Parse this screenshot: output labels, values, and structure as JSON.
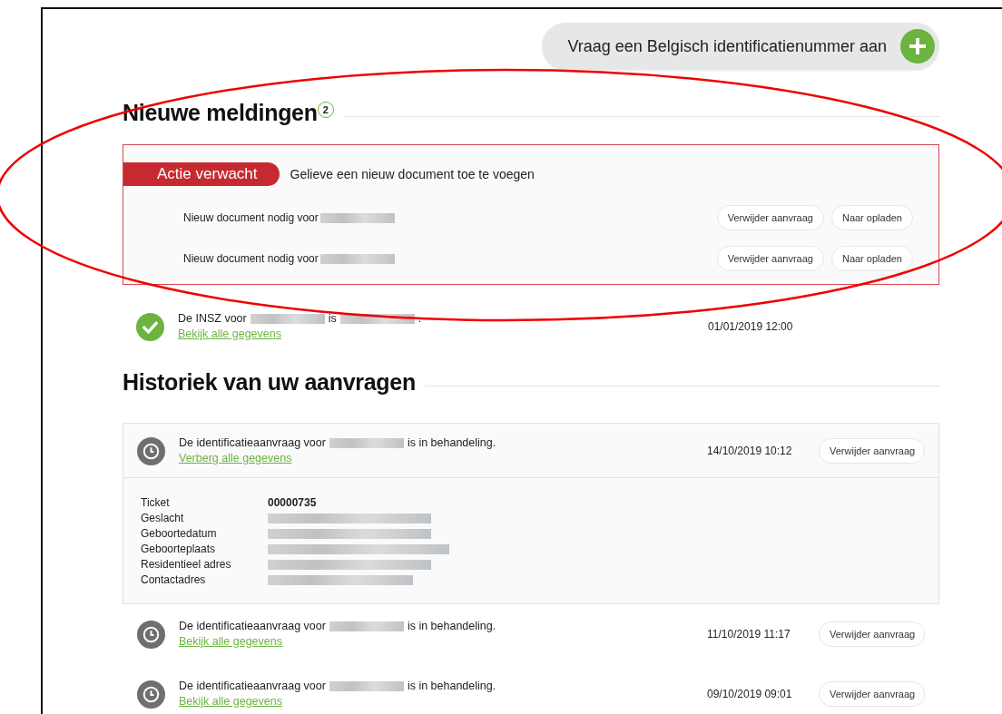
{
  "request_button": {
    "label": "Vraag een Belgisch identificatienummer aan"
  },
  "notifications": {
    "title": "Nieuwe meldingen",
    "count": "2",
    "alert": {
      "badge": "Actie verwacht",
      "message": "Gelieve een nieuw document toe te voegen",
      "items": [
        {
          "text": "Nieuw document nodig voor",
          "actions": [
            "Verwijder aanvraag",
            "Naar opladen"
          ]
        },
        {
          "text": "Nieuw document nodig voor",
          "actions": [
            "Verwijder aanvraag",
            "Naar opladen"
          ]
        }
      ]
    },
    "status_items": [
      {
        "kind": "success",
        "segments": [
          {
            "kind": "text",
            "text": "De INSZ voor"
          },
          {
            "kind": "redacted"
          },
          {
            "kind": "text",
            "text": "is"
          },
          {
            "kind": "redacted"
          },
          {
            "kind": "text",
            "text": "."
          }
        ],
        "link": "Bekijk alle gegevens",
        "date": "01/01/2019 12:00"
      }
    ]
  },
  "history": {
    "title": "Historiek van uw aanvragen",
    "items": [
      {
        "kind": "pending",
        "expanded": true,
        "segments": [
          {
            "kind": "text",
            "text": "De identificatieaanvraag voor"
          },
          {
            "kind": "redacted"
          },
          {
            "kind": "text",
            "text": "is in behandeling."
          }
        ],
        "link": "Verberg alle gegevens",
        "date": "14/10/2019 10:12",
        "button": "Verwijder aanvraag",
        "details": [
          {
            "label": "Ticket",
            "value": "00000735"
          },
          {
            "label": "Geslacht"
          },
          {
            "label": "Geboortedatum"
          },
          {
            "label": "Geboorteplaats"
          },
          {
            "label": "Residentieel adres"
          },
          {
            "label": "Contactadres"
          }
        ]
      },
      {
        "kind": "pending",
        "expanded": false,
        "segments": [
          {
            "kind": "text",
            "text": "De identificatieaanvraag voor"
          },
          {
            "kind": "redacted"
          },
          {
            "kind": "text",
            "text": "is in behandeling."
          }
        ],
        "link": "Bekijk alle gegevens",
        "date": "11/10/2019 11:17",
        "button": "Verwijder aanvraag"
      },
      {
        "kind": "pending",
        "expanded": false,
        "segments": [
          {
            "kind": "text",
            "text": "De identificatieaanvraag voor"
          },
          {
            "kind": "redacted"
          },
          {
            "kind": "text",
            "text": "is in behandeling."
          }
        ],
        "link": "Bekijk alle gegevens",
        "date": "09/10/2019 09:01",
        "button": "Verwijder aanvraag"
      }
    ]
  }
}
